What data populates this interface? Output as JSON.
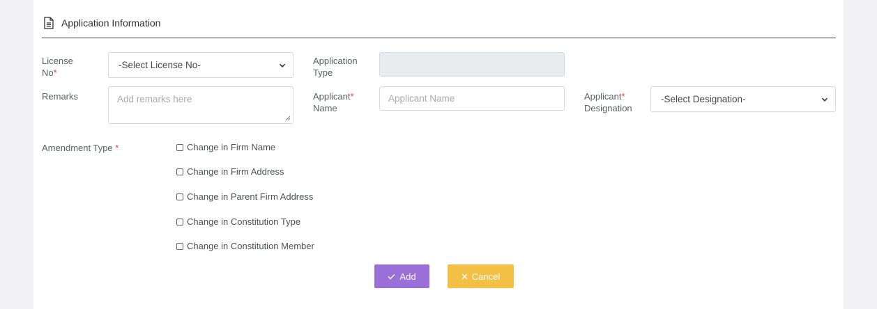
{
  "section": {
    "title": "Application Information",
    "icon": "document-icon"
  },
  "form": {
    "license_no": {
      "label": "License No",
      "required_mark": "*",
      "selected": "-Select License No-"
    },
    "application_type": {
      "label": "Application Type",
      "value": ""
    },
    "remarks": {
      "label": "Remarks",
      "placeholder": "Add remarks here"
    },
    "applicant_name": {
      "label": "Applicant",
      "label_suffix": "Name",
      "required_mark": "*",
      "placeholder": "Applicant Name"
    },
    "applicant_designation": {
      "label": "Applicant",
      "label_suffix": "Designation",
      "required_mark": "*",
      "selected": "-Select Designation-"
    },
    "amendment_type": {
      "label": "Amendment Type",
      "required_mark": "*",
      "options": [
        {
          "label": "Change in Firm Name",
          "checked": false
        },
        {
          "label": "Change in Firm Address",
          "checked": false
        },
        {
          "label": "Change in Parent Firm Address",
          "checked": false
        },
        {
          "label": "Change in Constitution Type",
          "checked": false
        },
        {
          "label": "Change in Constitution Member",
          "checked": false
        }
      ]
    }
  },
  "actions": {
    "add_label": "Add",
    "add_icon": "checkmark-icon",
    "cancel_label": "Cancel",
    "cancel_icon": "close-icon"
  },
  "colors": {
    "add_button": "#9b6fd8",
    "cancel_button": "#f4bf45",
    "required": "#e0453a"
  }
}
